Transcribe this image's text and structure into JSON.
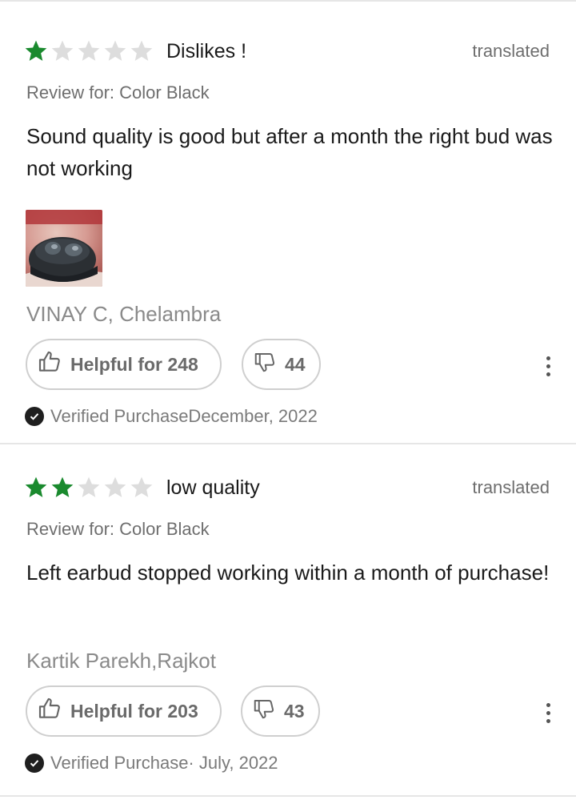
{
  "colors": {
    "star_filled": "#1a8a2e",
    "star_empty": "#dddddd"
  },
  "reviews": [
    {
      "rating": 1,
      "max_rating": 5,
      "title": "Dislikes !",
      "translated_label": "translated",
      "variant": "Review for: Color Black",
      "body": "Sound quality is good but after a month the right bud was not working",
      "has_photo": true,
      "photo_icon": "earbuds-case-photo",
      "author": "VINAY C, Chelambra",
      "helpful_label": "Helpful for 248",
      "dislike_count": "44",
      "verified_text": "Verified PurchaseDecember, 2022"
    },
    {
      "rating": 2,
      "max_rating": 5,
      "title": "low quality",
      "translated_label": "translated",
      "variant": "Review for: Color Black",
      "body": "Left earbud stopped working within a month of purchase!",
      "has_photo": false,
      "author": "Kartik Parekh,Rajkot",
      "helpful_label": "Helpful for 203",
      "dislike_count": "43",
      "verified_text": "Verified Purchase· July, 2022"
    }
  ]
}
